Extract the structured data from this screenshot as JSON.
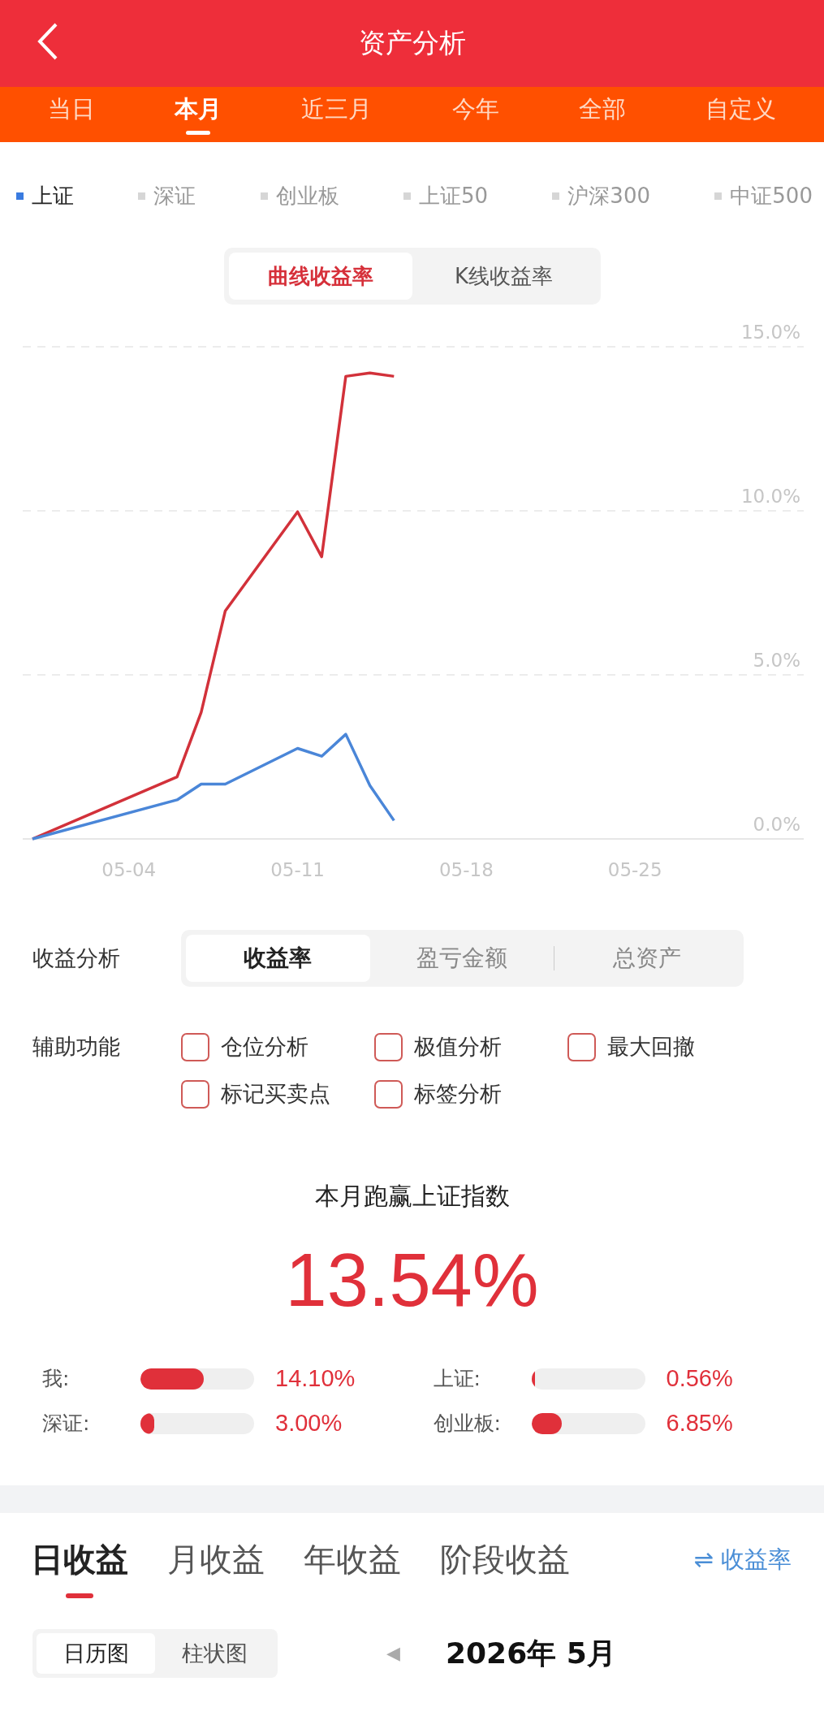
{
  "header": {
    "title": "资产分析"
  },
  "periods": [
    {
      "label": "当日",
      "selected": false
    },
    {
      "label": "本月",
      "selected": true
    },
    {
      "label": "近三月",
      "selected": false
    },
    {
      "label": "今年",
      "selected": false
    },
    {
      "label": "全部",
      "selected": false
    },
    {
      "label": "自定义",
      "selected": false
    }
  ],
  "indices": [
    {
      "label": "上证",
      "selected": true
    },
    {
      "label": "深证",
      "selected": false
    },
    {
      "label": "创业板",
      "selected": false
    },
    {
      "label": "上证50",
      "selected": false
    },
    {
      "label": "沪深300",
      "selected": false
    },
    {
      "label": "中证500",
      "selected": false
    }
  ],
  "chart_modes": [
    {
      "label": "曲线收益率",
      "selected": true
    },
    {
      "label": "K线收益率",
      "selected": false
    }
  ],
  "chart": {
    "chart_data": {
      "type": "line",
      "categories": [
        null,
        null,
        null,
        null,
        "05-04",
        null,
        null,
        null,
        null,
        null,
        null,
        "05-11",
        null,
        null,
        null,
        null,
        null,
        null,
        "05-18",
        null,
        null,
        null,
        null,
        null,
        null,
        "05-25",
        null,
        null,
        null,
        null,
        null,
        null,
        null
      ],
      "ylim": [
        0,
        15
      ],
      "yticks": [
        {
          "value": 0,
          "label": "0.0%"
        },
        {
          "value": 5,
          "label": "5.0%"
        },
        {
          "value": 10,
          "label": "10.0%"
        },
        {
          "value": 15,
          "label": "15.0%"
        }
      ],
      "series": [
        {
          "color": "#d2313a",
          "values": [
            0,
            null,
            null,
            null,
            null,
            null,
            1.89,
            3.86,
            6.95,
            null,
            null,
            9.97,
            8.6,
            14.1,
            14.2,
            14.1,
            null,
            null,
            null,
            null,
            null,
            null,
            null,
            null,
            null,
            null,
            null,
            null,
            null,
            null,
            null,
            null,
            null
          ]
        },
        {
          "color": "#4a86d8",
          "values": [
            0,
            null,
            null,
            null,
            null,
            null,
            1.19,
            1.67,
            1.67,
            null,
            null,
            2.76,
            2.52,
            3.19,
            1.63,
            0.56,
            null,
            null,
            null,
            null,
            null,
            null,
            null,
            null,
            null,
            null,
            null,
            null,
            null,
            null,
            null,
            null,
            null
          ]
        }
      ]
    }
  },
  "analysis": {
    "label": "收益分析",
    "options": [
      {
        "label": "收益率",
        "selected": true
      },
      {
        "label": "盈亏金额",
        "selected": false
      },
      {
        "label": "总资产",
        "selected": false
      }
    ]
  },
  "tools": {
    "label": "辅助功能",
    "items": [
      {
        "label": "仓位分析",
        "checked": false
      },
      {
        "label": "极值分析",
        "checked": false
      },
      {
        "label": "最大回撤",
        "checked": false
      },
      {
        "label": "标记买卖点",
        "checked": false
      },
      {
        "label": "标签分析",
        "checked": false
      }
    ]
  },
  "summary": {
    "title": "本月跑赢上证指数",
    "value": "13.54%"
  },
  "comparisons": [
    {
      "label": "我:",
      "level": 0.56,
      "reading": "14.10%"
    },
    {
      "label": "上证:",
      "level": 0.03,
      "reading": "0.56%"
    },
    {
      "label": "深证:",
      "level": 0.12,
      "reading": "3.00%"
    },
    {
      "label": "创业板:",
      "level": 0.27,
      "reading": "6.85%"
    }
  ],
  "income_tabs": [
    {
      "label": "日收益",
      "selected": true
    },
    {
      "label": "月收益",
      "selected": false
    },
    {
      "label": "年收益",
      "selected": false
    },
    {
      "label": "阶段收益",
      "selected": false
    }
  ],
  "rate_toggle": {
    "icon": "⇌",
    "label": "收益率"
  },
  "view_modes": [
    {
      "label": "日历图",
      "selected": true
    },
    {
      "label": "柱状图",
      "selected": false
    }
  ],
  "month": {
    "prev": "◀",
    "label": "2026年 5月"
  }
}
